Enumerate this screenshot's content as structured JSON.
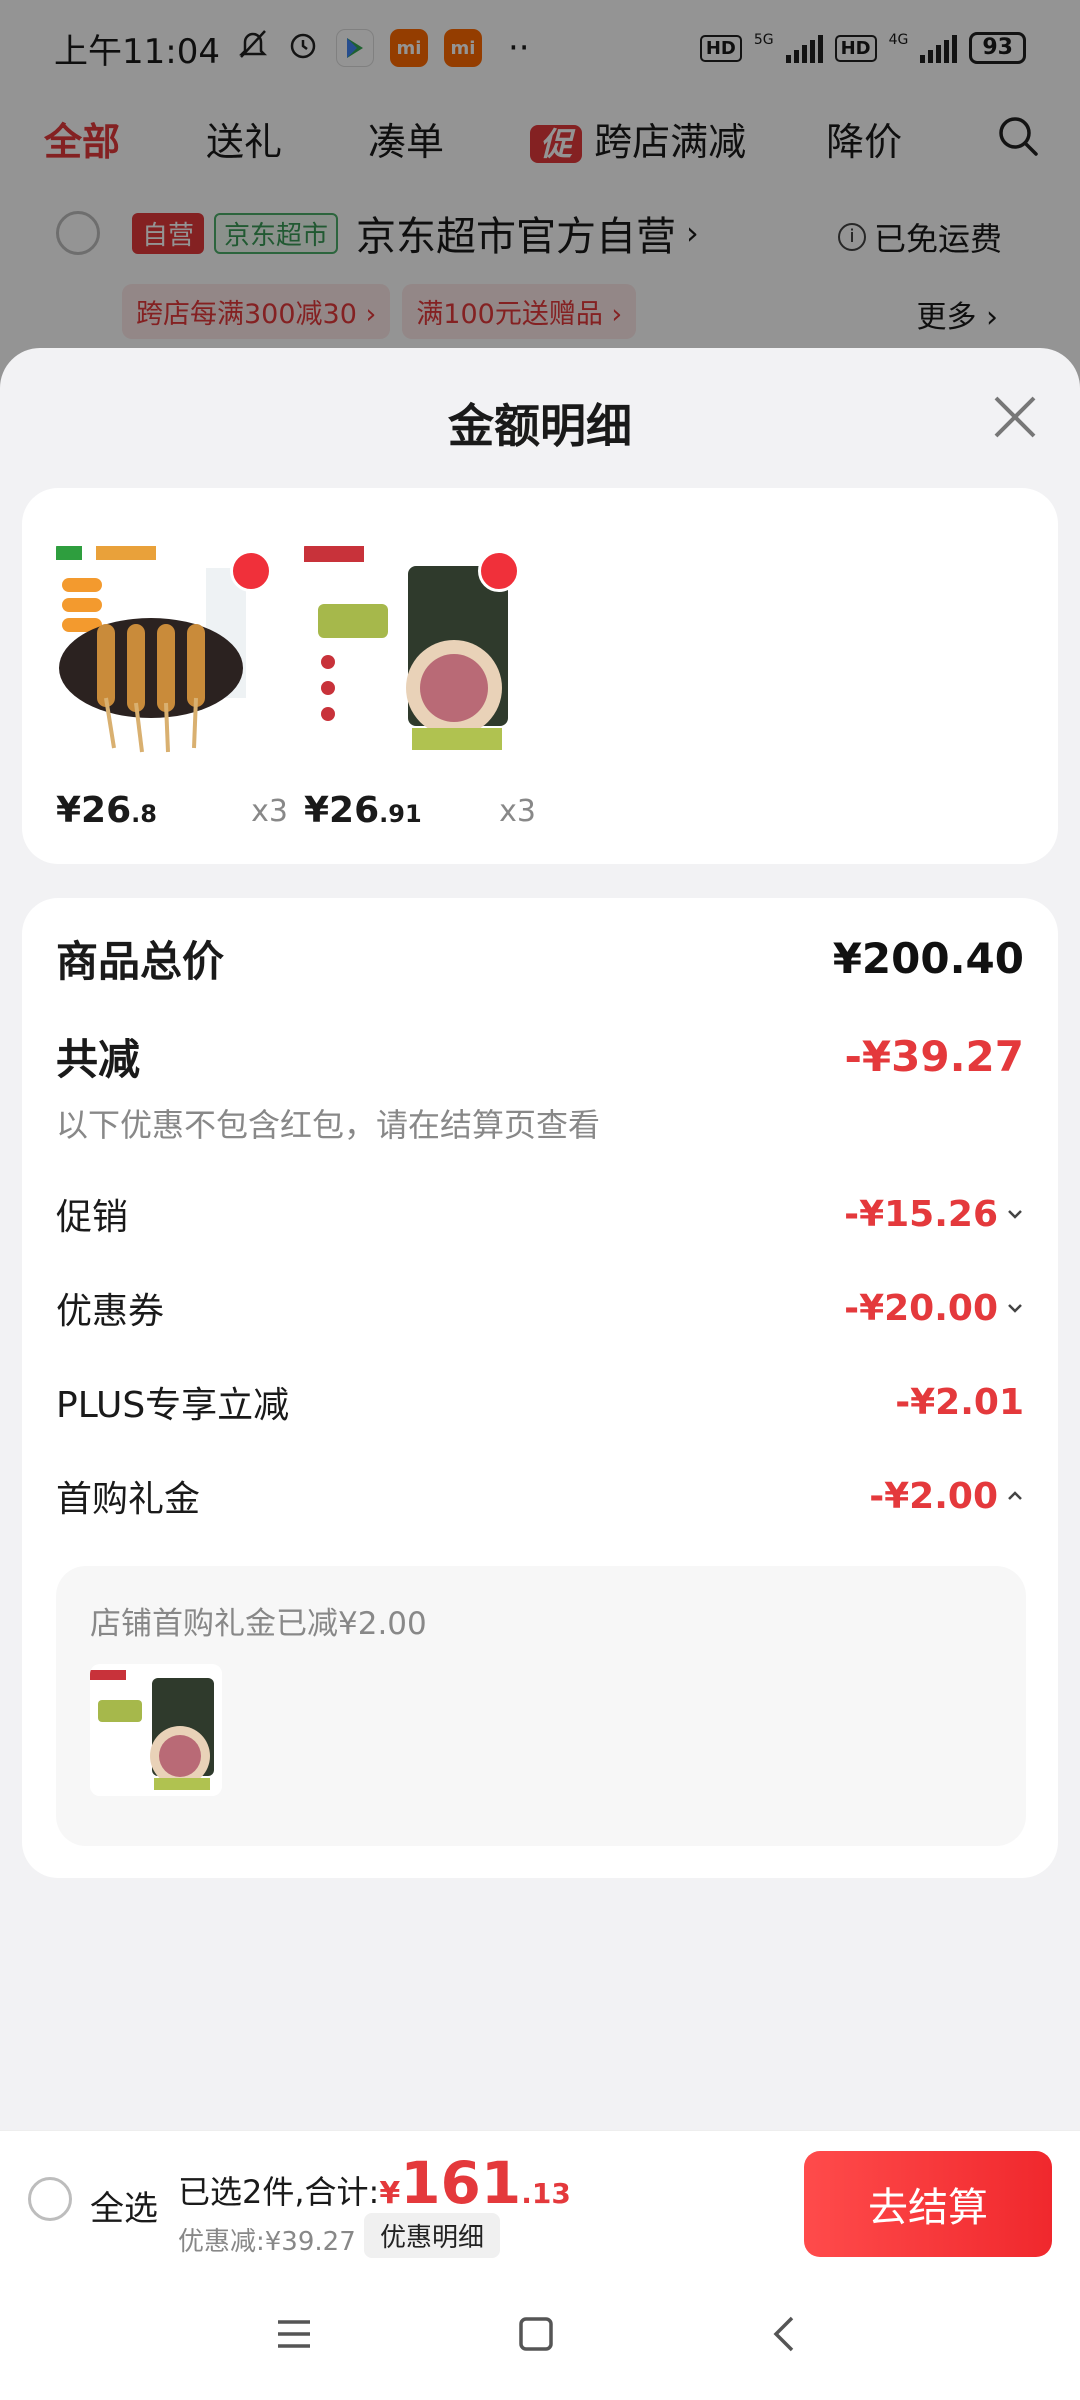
{
  "status_bar": {
    "time": "上午11:04",
    "net1": "5G",
    "net2": "4G",
    "battery": "93",
    "hd": "HD"
  },
  "tabs": [
    {
      "label": "全部",
      "active": true
    },
    {
      "label": "送礼"
    },
    {
      "label": "凑单"
    },
    {
      "label": "跨店满减",
      "tag": "促"
    },
    {
      "label": "降价"
    }
  ],
  "store": {
    "self_tag": "自营",
    "market_tag": "京东超市",
    "name": "京东超市官方自营",
    "free_shipping": "已免运费",
    "chips": [
      "跨店每满300减30 ›",
      "满100元送赠品 ›"
    ],
    "more": "更多 ›"
  },
  "sheet": {
    "title": "金额明细",
    "goods": [
      {
        "price_main": "¥26",
        "price_dec": ".8",
        "qty": "x3",
        "icon": "skewer-product-image"
      },
      {
        "price_main": "¥26",
        "price_dec": ".91",
        "qty": "x3",
        "icon": "meat-product-image"
      }
    ],
    "total_label": "商品总价",
    "total_value": "¥200.40",
    "reduce_label": "共减",
    "reduce_value": "-¥39.27",
    "note": "以下优惠不包含红包，请在结算页查看",
    "items": [
      {
        "label": "促销",
        "value": "-¥15.26",
        "chevron": "down"
      },
      {
        "label": "优惠券",
        "value": "-¥20.00",
        "chevron": "down"
      },
      {
        "label": "PLUS专享立减",
        "value": "-¥2.01",
        "chevron": ""
      },
      {
        "label": "首购礼金",
        "value": "-¥2.00",
        "chevron": "up"
      }
    ],
    "gift_note": "店铺首购礼金已减¥2.00"
  },
  "bottom": {
    "select_all": "全选",
    "summary_prefix": "已选2件,合计:",
    "currency": "¥",
    "total_int": "161",
    "total_dec": ".13",
    "saved": "优惠减:¥39.27",
    "detail_button": "优惠明细",
    "checkout": "去结算"
  },
  "colors": {
    "accent": "#e4393c",
    "checkout": "#f0282d"
  }
}
